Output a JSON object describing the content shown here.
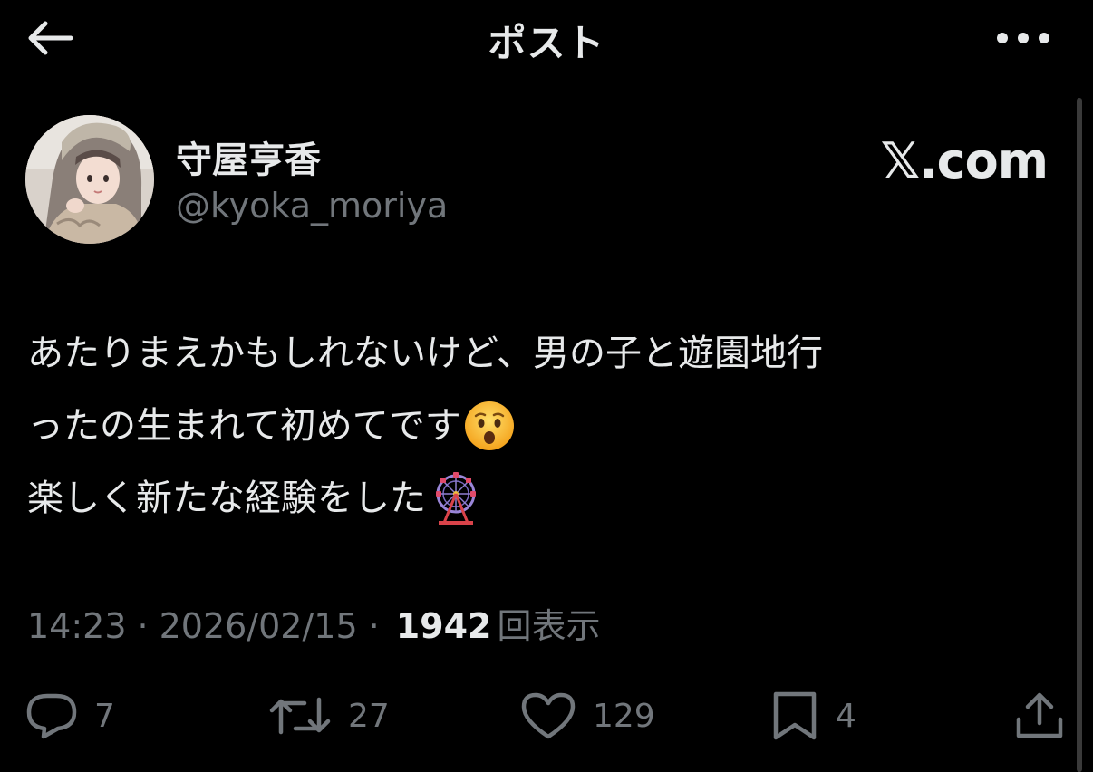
{
  "header": {
    "title": "ポスト",
    "back_icon": "arrow-left-icon",
    "more_icon": "more-horizontal-icon"
  },
  "author": {
    "name": "守屋亨香",
    "handle": "@kyoka_moriya",
    "avatar": "profile-photo"
  },
  "brand": {
    "logo": "𝕏",
    "suffix": ".com"
  },
  "post": {
    "lines": [
      "あたりまえかもしれないけど、男の子と遊園地行",
      "ったの生まれて初めてです",
      "楽しく新たな経験をした"
    ],
    "emojis": [
      "hushed-face-emoji",
      "ferris-wheel-emoji"
    ]
  },
  "meta": {
    "time": "14:23",
    "date": "2026/02/15",
    "views_count": "1942",
    "views_label": "回表示",
    "separator": "·"
  },
  "actions": {
    "reply_count": "7",
    "repost_count": "27",
    "like_count": "129",
    "bookmark_count": "4"
  },
  "colors": {
    "background": "#000000",
    "text_primary": "#e7e9ea",
    "text_secondary": "#71767b"
  }
}
